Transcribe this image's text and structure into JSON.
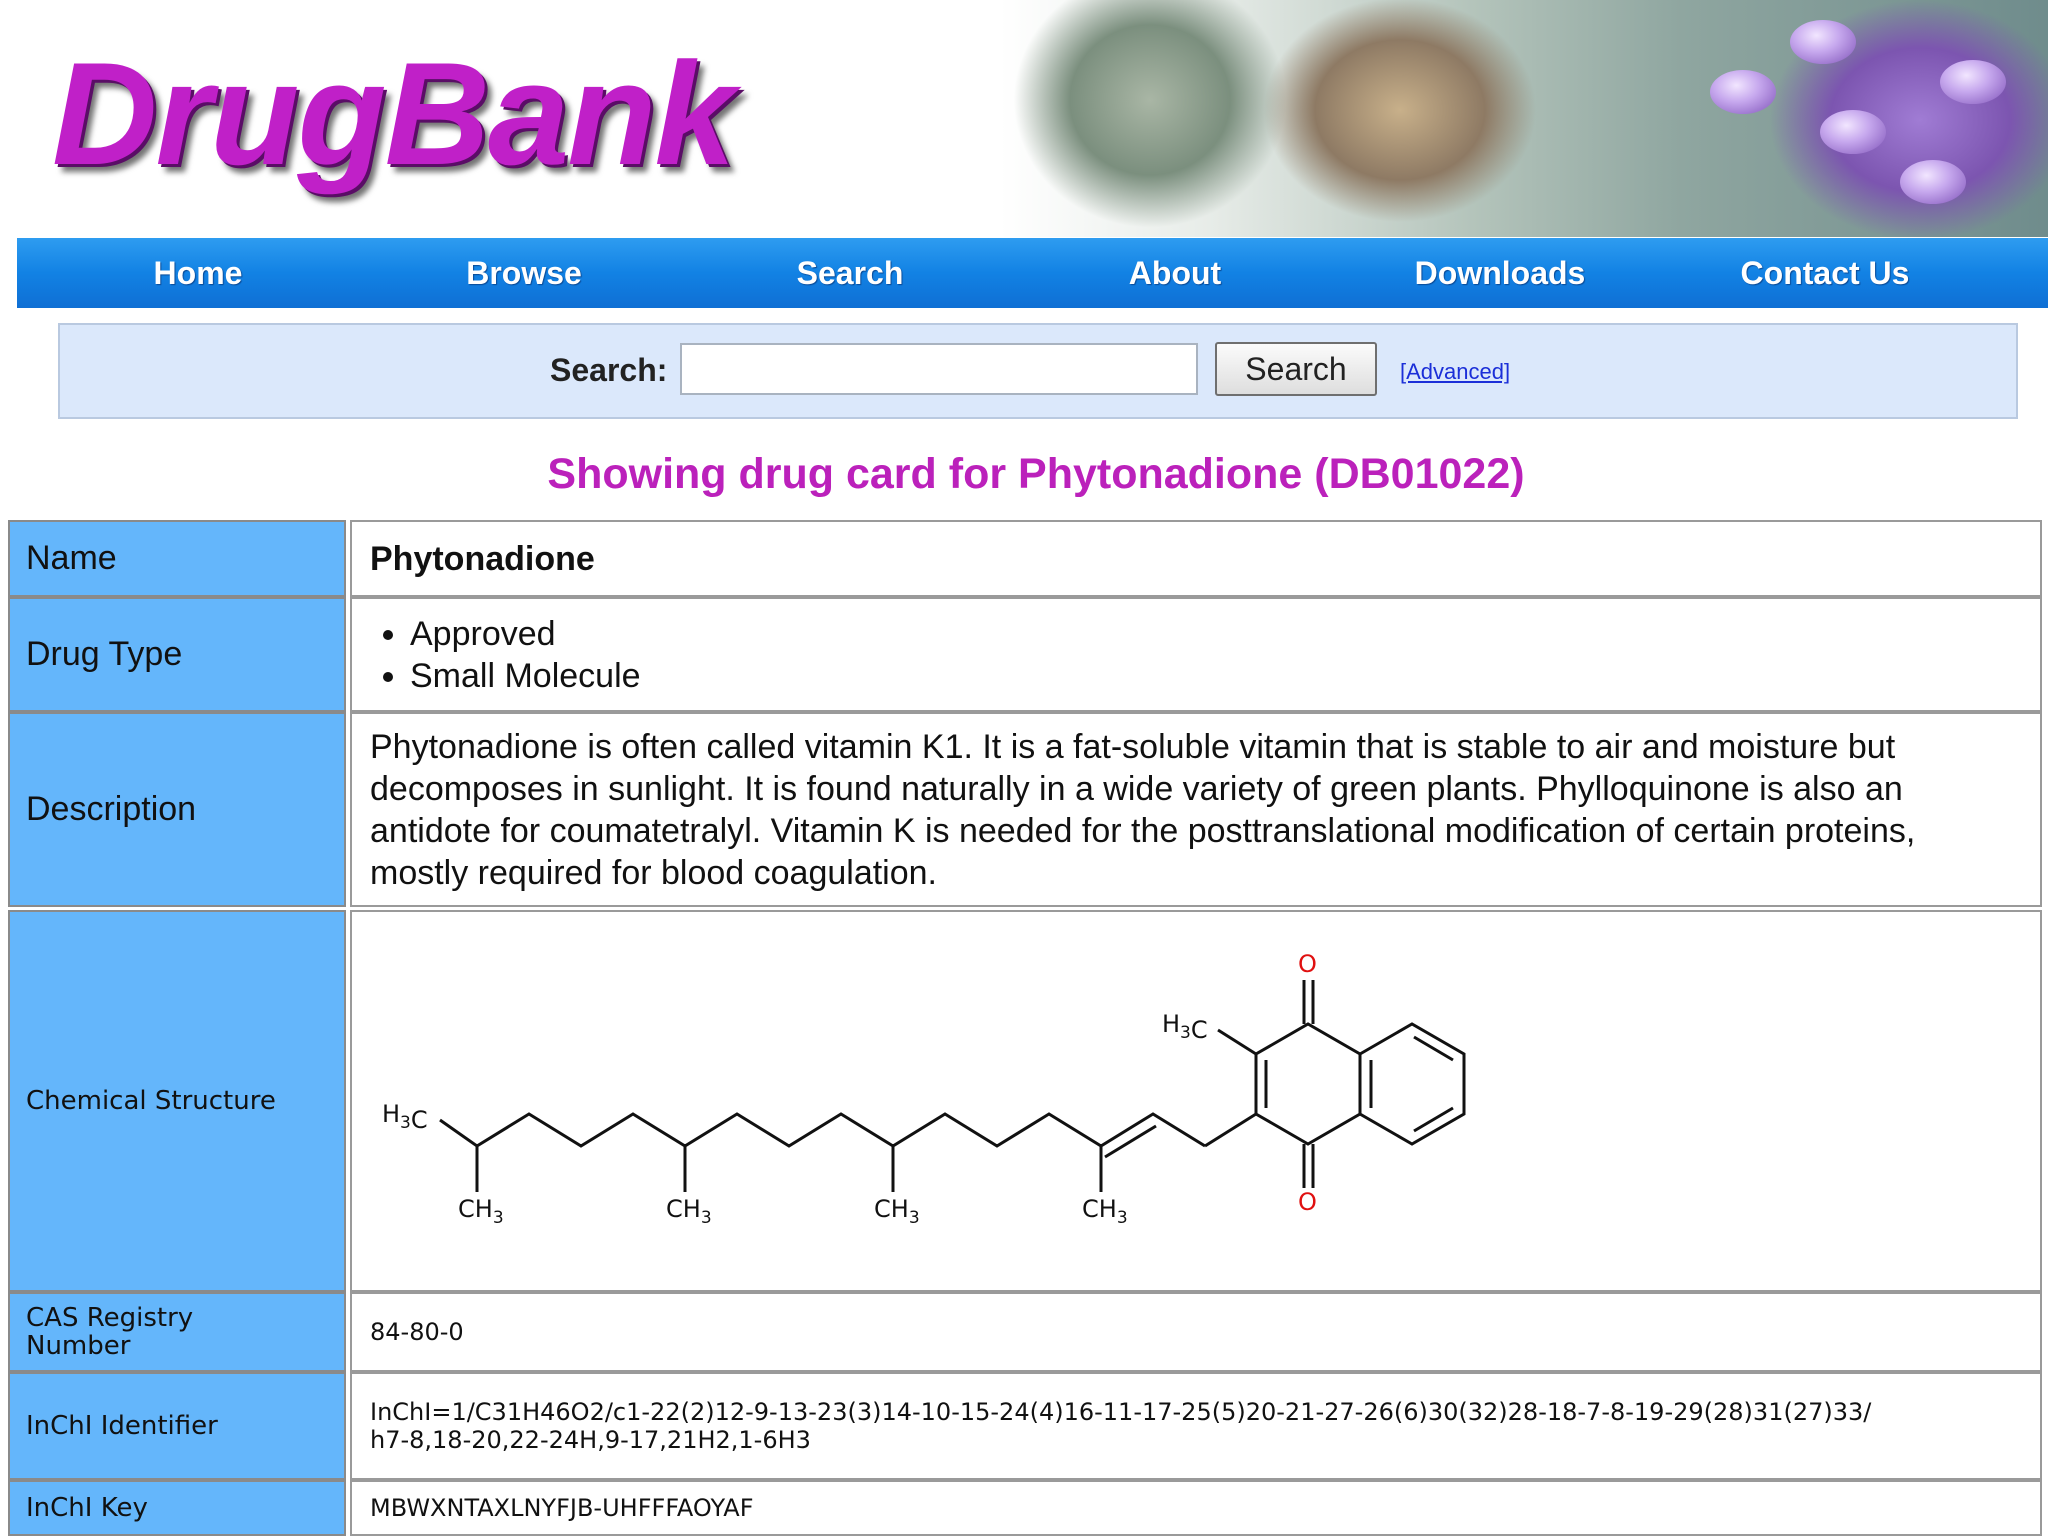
{
  "header": {
    "logo_text": "DrugBank"
  },
  "nav": {
    "items": [
      "Home",
      "Browse",
      "Search",
      "About",
      "Downloads",
      "Contact Us"
    ]
  },
  "search": {
    "label": "Search:",
    "value": "",
    "placeholder": "",
    "button_label": "Search",
    "advanced_label": "[Advanced]"
  },
  "page_title": "Showing drug card for Phytonadione (DB01022)",
  "drug_card": {
    "name_label": "Name",
    "name": "Phytonadione",
    "drug_type_label": "Drug Type",
    "drug_types": [
      "Approved",
      "Small Molecule"
    ],
    "description_label": "Description",
    "description": "Phytonadione is often called vitamin K1. It is a fat-soluble vitamin that is stable to air and moisture but decomposes in sunlight. It is found naturally in a wide variety of green plants. Phylloquinone is also an antidote for coumatetralyl. Vitamin K is needed for the posttranslational modification of certain proteins, mostly required for blood coagulation.",
    "structure_label": "Chemical Structure",
    "cas_label": "CAS Registry Number",
    "cas": "84-80-0",
    "inchi_label": "InChI Identifier",
    "inchi": "InChI=1/C31H46O2/c1-22(2)12-9-13-23(3)14-10-15-24(4)16-11-17-25(5)20-21-27-26(6)30(32)28-18-7-8-19-29(28)31(27)33/h7-8,18-20,22-24H,9-17,21H2,1-6H3",
    "inchi_key_label": "InChI Key",
    "inchi_key": "MBWXNTAXLNYFJB-UHFFFAOYAF"
  },
  "structure": {
    "atom_labels": {
      "h3c_left": "H3C",
      "h3c_ring": "H3C",
      "ch3": "CH3",
      "oxygen": "O"
    },
    "oxygen_color": "#e01010"
  }
}
